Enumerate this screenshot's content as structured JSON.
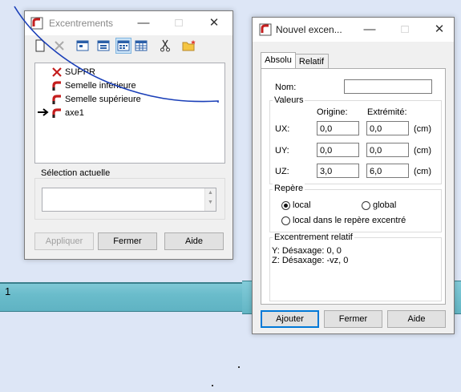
{
  "background": {
    "beam_label": "1"
  },
  "excentrements_window": {
    "title": "Excentrements",
    "toolbar": [
      "new-icon",
      "delete-icon",
      "view1-icon",
      "view2-icon",
      "view3-icon",
      "table-icon",
      "cut-icon",
      "folder-icon"
    ],
    "list_items": [
      {
        "label": "SUPPR",
        "icon": "delete-x-icon"
      },
      {
        "label": "Semelle inférieure",
        "icon": "eccentric-icon"
      },
      {
        "label": "Semelle supérieure",
        "icon": "eccentric-icon"
      },
      {
        "label": "axe1",
        "icon": "eccentric-icon",
        "current": true
      }
    ],
    "selection_label": "Sélection actuelle",
    "selection_value": "",
    "buttons": {
      "apply": "Appliquer",
      "close": "Fermer",
      "help": "Aide"
    }
  },
  "nouvel_window": {
    "title": "Nouvel excen...",
    "tabs": [
      "Absolu",
      "Relatif"
    ],
    "nom_label": "Nom:",
    "nom_value": "",
    "valeurs": {
      "title": "Valeurs",
      "origin_header": "Origine:",
      "end_header": "Extrémité:",
      "rows": [
        {
          "label": "UX:",
          "origin": "0,0",
          "end": "0,0",
          "unit": "(cm)"
        },
        {
          "label": "UY:",
          "origin": "0,0",
          "end": "0,0",
          "unit": "(cm)"
        },
        {
          "label": "UZ:",
          "origin": "3,0",
          "end": "6,0",
          "unit": "(cm)"
        }
      ]
    },
    "repere": {
      "title": "Repère",
      "local": "local",
      "global": "global",
      "local_excentre": "local dans le repère excentré",
      "selected": "local"
    },
    "relatif": {
      "title": "Excentrement relatif",
      "line1": "Y: Désaxage:  0, 0",
      "line2": "Z: Désaxage:  -vz, 0"
    },
    "buttons": {
      "add": "Ajouter",
      "close": "Fermer",
      "help": "Aide"
    }
  },
  "colors": {
    "accent": "#0078d7",
    "beam": "#6abccb",
    "annotation": "#1a3fb8",
    "icon_red": "#c41e1e"
  }
}
